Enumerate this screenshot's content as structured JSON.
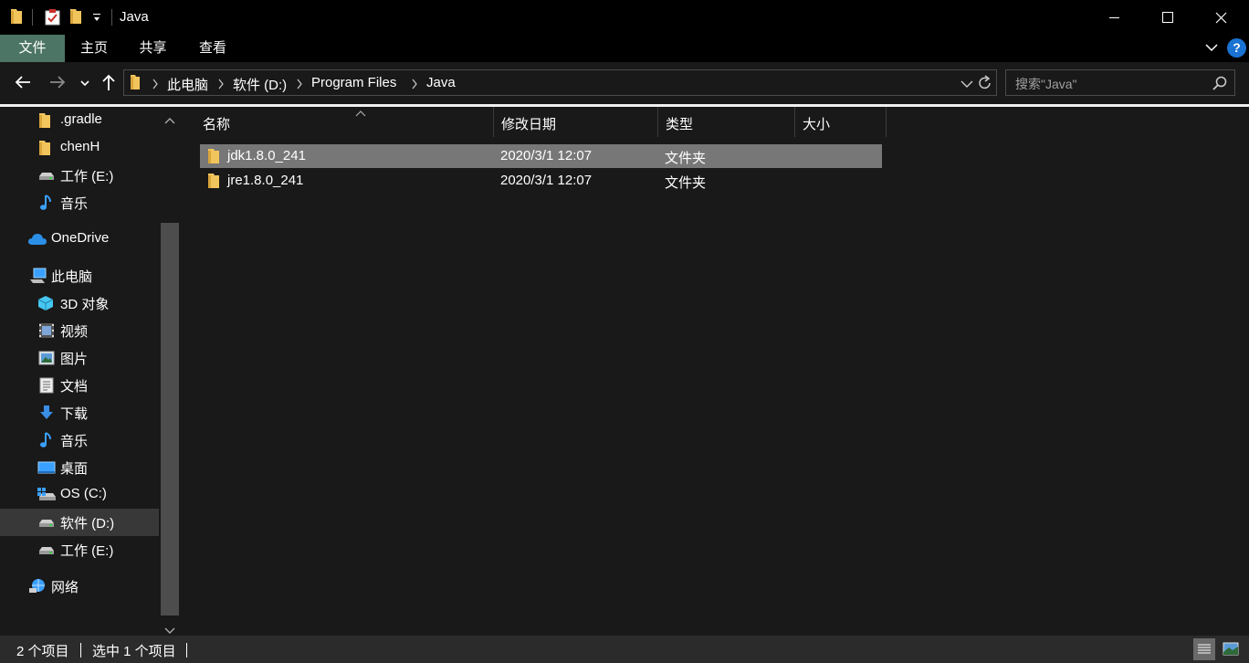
{
  "window": {
    "title": "Java"
  },
  "ribbon": {
    "tabs": [
      "文件",
      "主页",
      "共享",
      "查看"
    ],
    "help_label": "?"
  },
  "address": {
    "crumbs": [
      "此电脑",
      "软件 (D:)",
      "Program Files",
      "Java"
    ]
  },
  "search": {
    "placeholder": "搜索\"Java\""
  },
  "sidebar": {
    "items": [
      {
        "label": ".gradle",
        "icon": "folder-icon"
      },
      {
        "label": "chenH",
        "icon": "folder-icon"
      },
      {
        "label": "工作 (E:)",
        "icon": "drive-icon"
      },
      {
        "label": "音乐",
        "icon": "music-icon"
      },
      {
        "label": "OneDrive",
        "icon": "cloud-icon"
      },
      {
        "label": "此电脑",
        "icon": "computer-icon"
      },
      {
        "label": "3D 对象",
        "icon": "cube-icon"
      },
      {
        "label": "视频",
        "icon": "video-icon"
      },
      {
        "label": "图片",
        "icon": "pictures-icon"
      },
      {
        "label": "文档",
        "icon": "document-icon"
      },
      {
        "label": "下载",
        "icon": "download-icon"
      },
      {
        "label": "音乐",
        "icon": "music-icon"
      },
      {
        "label": "桌面",
        "icon": "desktop-icon"
      },
      {
        "label": "OS (C:)",
        "icon": "windows-drive-icon"
      },
      {
        "label": "软件 (D:)",
        "icon": "drive-icon"
      },
      {
        "label": "工作 (E:)",
        "icon": "drive-icon"
      },
      {
        "label": "网络",
        "icon": "network-icon"
      }
    ],
    "selected": "软件 (D:)"
  },
  "columns": [
    "名称",
    "修改日期",
    "类型",
    "大小"
  ],
  "files": [
    {
      "name": "jdk1.8.0_241",
      "modified": "2020/3/1 12:07",
      "type": "文件夹",
      "size": ""
    },
    {
      "name": "jre1.8.0_241",
      "modified": "2020/3/1 12:07",
      "type": "文件夹",
      "size": ""
    }
  ],
  "status": {
    "count": "2 个项目",
    "selection": "选中 1 个项目"
  },
  "colors": {
    "accent_file_tab": "#4d7566",
    "folder": "#f2c45c",
    "selection": "#777777",
    "help": "#1a73d1"
  }
}
